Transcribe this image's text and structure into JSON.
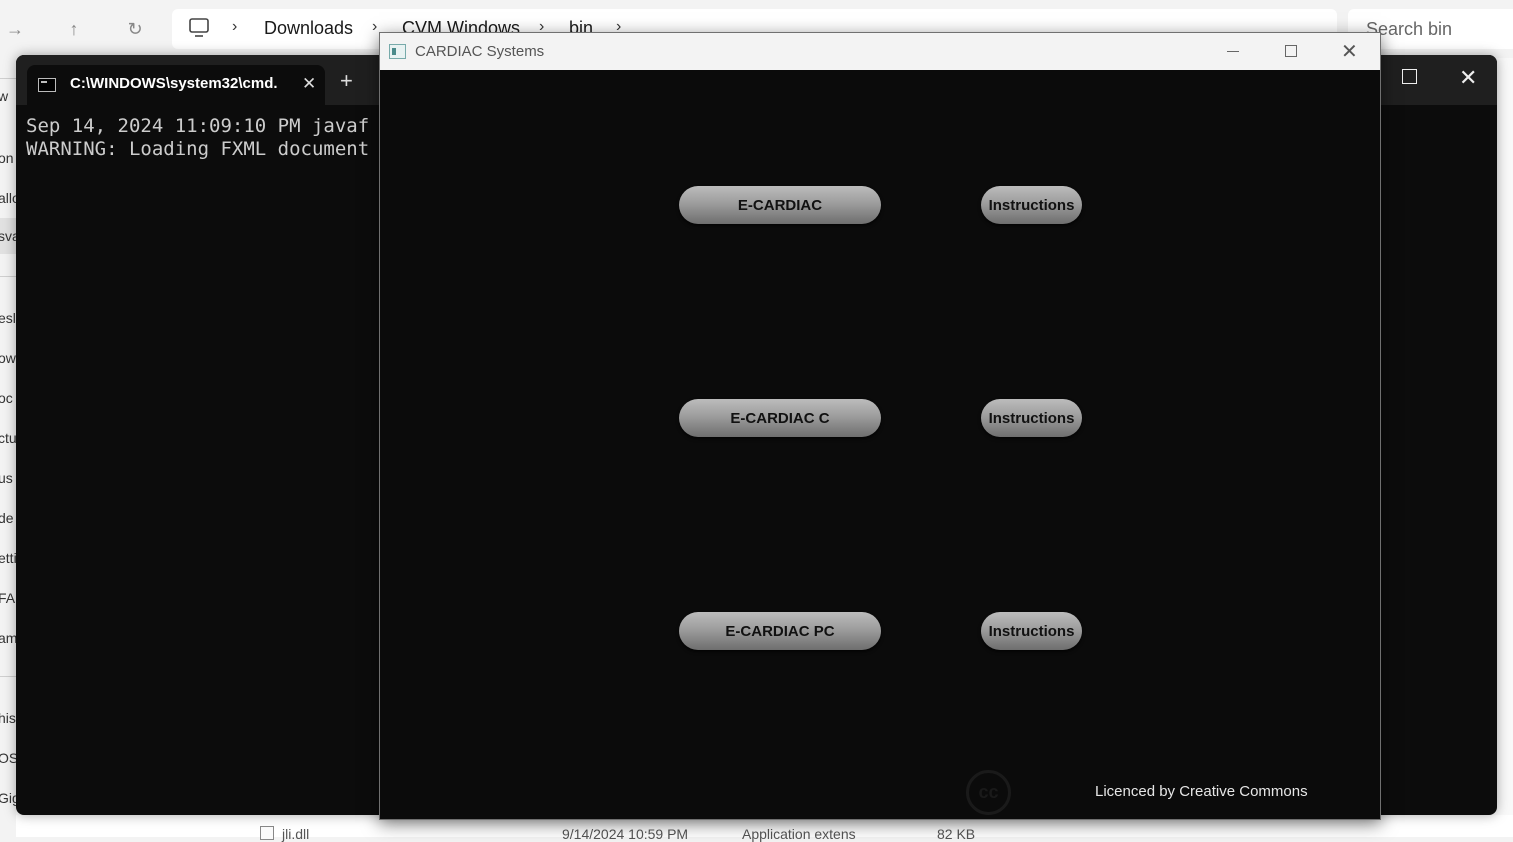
{
  "explorer": {
    "nav": {
      "forward_icon": "arrow-right-icon",
      "up_icon": "arrow-up-icon",
      "refresh_icon": "refresh-icon"
    },
    "breadcrumbs": [
      "Downloads",
      "CVM Windows",
      "bin"
    ],
    "search_placeholder": "Search bin",
    "sidebar_fragments": [
      "w",
      "on",
      "allo",
      "sva",
      "esl",
      "ow",
      "oc",
      "ctu",
      "us",
      "de",
      "etti",
      "FA",
      "am",
      "his",
      "OS",
      "Gig"
    ],
    "bottom_row": {
      "file_name": "jli.dll",
      "date": "9/14/2024 10:59 PM",
      "type": "Application extens",
      "size": "82 KB"
    }
  },
  "terminal": {
    "tab_label": "C:\\WINDOWS\\system32\\cmd.",
    "new_tab": "+",
    "lines": [
      "Sep 14, 2024 11:09:10 PM javaf",
      "WARNING: Loading FXML document"
    ]
  },
  "app": {
    "title": "CARDIAC Systems",
    "buttons": [
      {
        "label": "E-CARDIAC",
        "instructions": "Instructions"
      },
      {
        "label": "E-CARDIAC C",
        "instructions": "Instructions"
      },
      {
        "label": "E-CARDIAC PC",
        "instructions": "Instructions"
      }
    ],
    "cc_logo": "cc",
    "license": "Licenced by Creative Commons"
  },
  "colors": {
    "app_background": "#0b0b0b",
    "terminal_background": "#0c0c0c",
    "button_gradient_top": "#bcbcbc",
    "button_gradient_bottom": "#6e6e6e",
    "license_text": "#e6e6e6"
  }
}
